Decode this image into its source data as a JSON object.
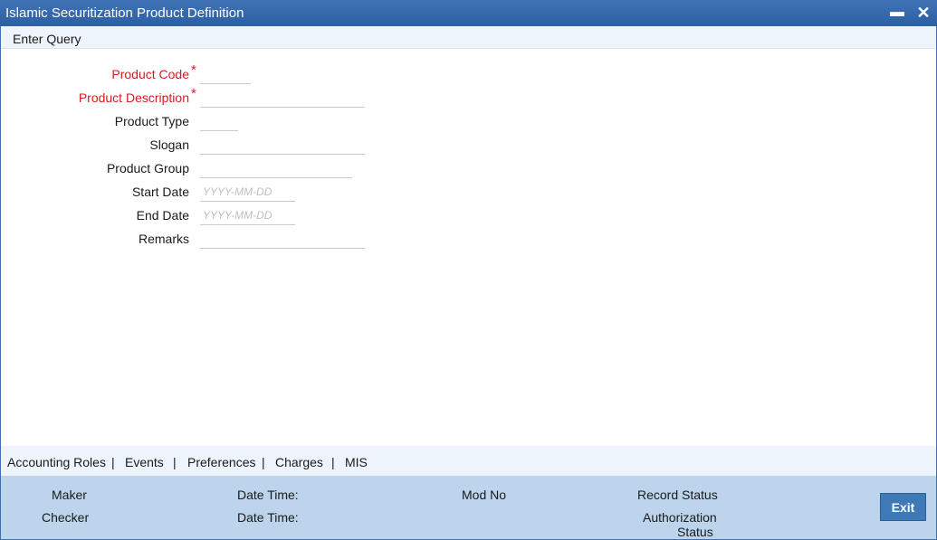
{
  "window": {
    "title": "Islamic Securitization Product Definition",
    "minimize_glyph": "▬",
    "close_glyph": "✕"
  },
  "toolbar": {
    "enter_query": "Enter Query"
  },
  "form": {
    "required_marker": "*",
    "product_code": {
      "label": "Product Code",
      "value": ""
    },
    "product_description": {
      "label": "Product Description",
      "value": ""
    },
    "product_type": {
      "label": "Product Type",
      "value": ""
    },
    "slogan": {
      "label": "Slogan",
      "value": ""
    },
    "product_group": {
      "label": "Product Group",
      "value": ""
    },
    "start_date": {
      "label": "Start Date",
      "placeholder": "YYYY-MM-DD"
    },
    "end_date": {
      "label": "End Date",
      "placeholder": "YYYY-MM-DD"
    },
    "remarks": {
      "label": "Remarks",
      "value": ""
    }
  },
  "tabs": {
    "accounting_roles": "Accounting Roles",
    "events": "Events",
    "preferences": "Preferences",
    "charges": "Charges",
    "mis": "MIS",
    "separator": "|"
  },
  "audit": {
    "maker": "Maker",
    "checker": "Checker",
    "date_time_1": "Date Time:",
    "date_time_2": "Date Time:",
    "mod_no": "Mod No",
    "record_status": "Record Status",
    "authorization": "Authorization",
    "status": "Status"
  },
  "buttons": {
    "exit": "Exit"
  },
  "colors": {
    "titlebar": "#2d5fa3",
    "required_label": "#d21e1e",
    "audit_panel": "#bcd5ec",
    "exit_button": "#3e7ab8"
  }
}
